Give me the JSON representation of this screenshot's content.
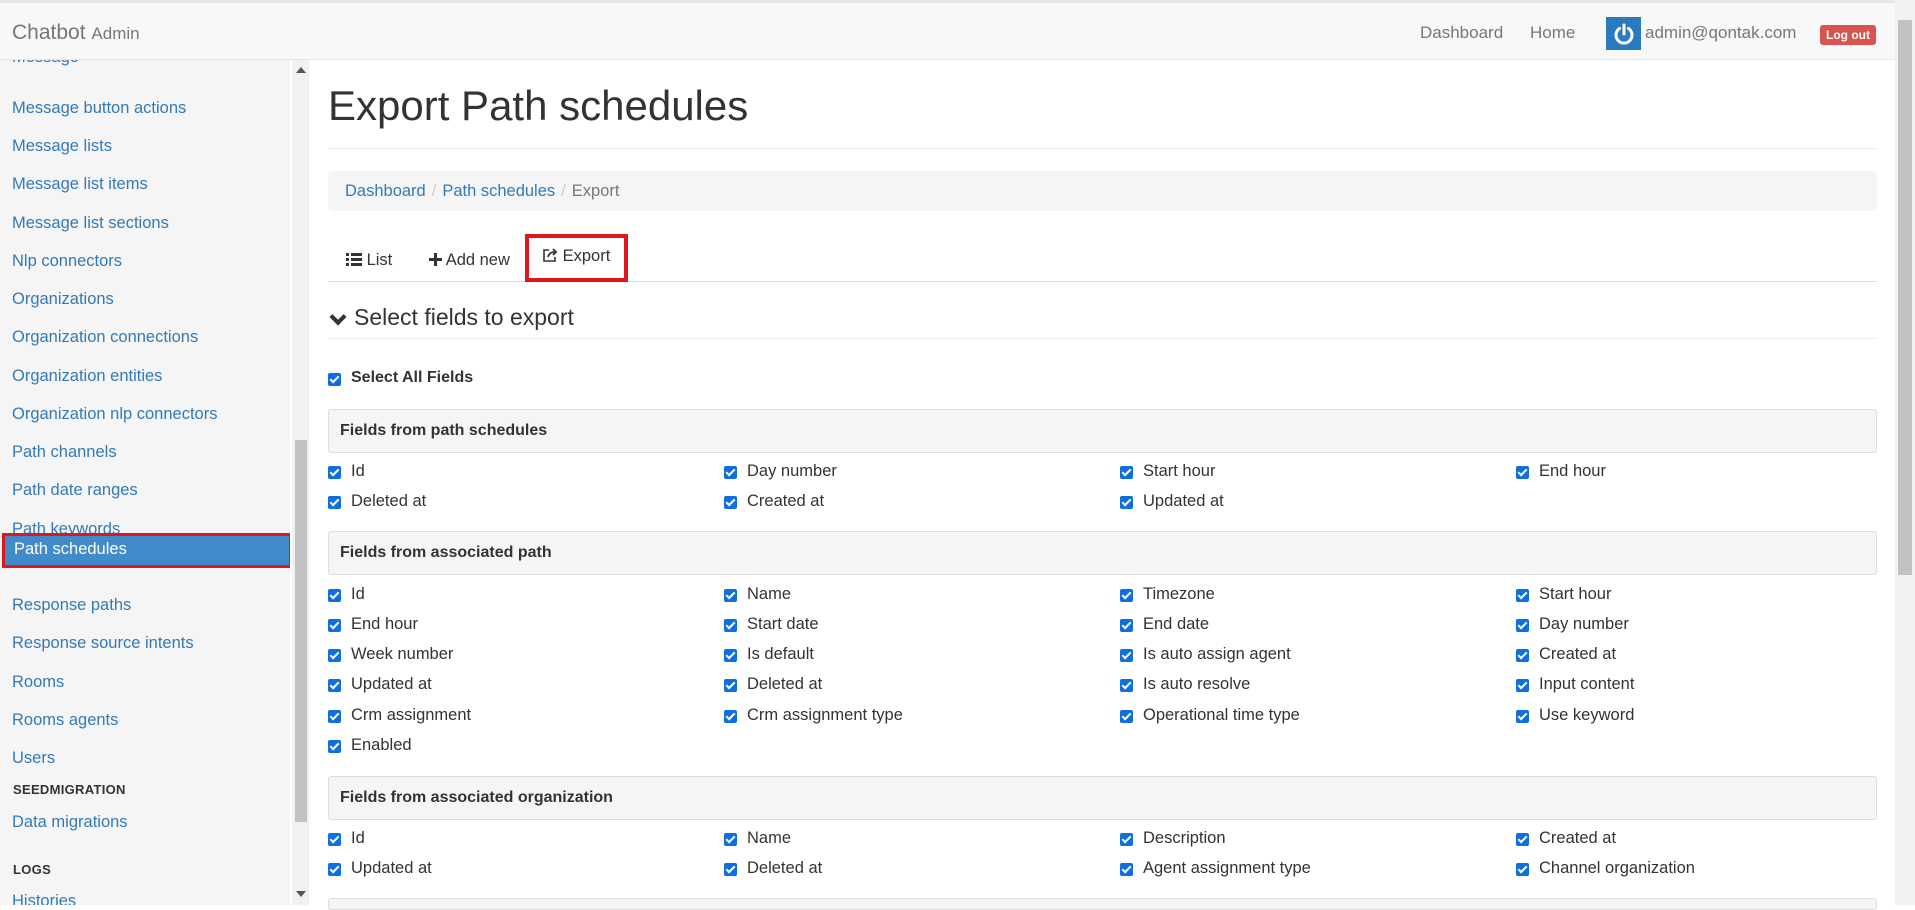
{
  "navbar": {
    "brand": "Chatbot",
    "brand_sub": "Admin",
    "links": [
      "Dashboard",
      "Home"
    ],
    "user_email": "admin@qontak.com",
    "logout_label": "Log out",
    "avatar_icon": "power-icon"
  },
  "sidebar": {
    "items": [
      "Message button actions",
      "Message lists",
      "Message list items",
      "Message list sections",
      "Nlp connectors",
      "Organizations",
      "Organization connections",
      "Organization entities",
      "Organization nlp connectors",
      "Path channels",
      "Path date ranges",
      "Path keywords",
      "Path schedules",
      "Response paths",
      "Response source intents",
      "Rooms",
      "Rooms agents",
      "Users"
    ],
    "active_item": "Path schedules",
    "seed_header": "SEEDMIGRATION",
    "seed_items": [
      "Data migrations"
    ],
    "logs_header": "LOGS",
    "logs_items": [
      "Histories"
    ]
  },
  "page": {
    "title": "Export Path schedules",
    "breadcrumb": [
      "Dashboard",
      "Path schedules",
      "Export"
    ],
    "tabs": {
      "list": "List",
      "add_new": "Add new",
      "export": "Export"
    },
    "section_title": "Select fields to export",
    "select_all_label": "Select All Fields"
  },
  "groups": [
    {
      "title": "Fields from path schedules",
      "fields": [
        "Id",
        "Day number",
        "Start hour",
        "End hour",
        "Deleted at",
        "Created at",
        "Updated at"
      ]
    },
    {
      "title": "Fields from associated path",
      "fields": [
        "Id",
        "Name",
        "Timezone",
        "Start hour",
        "End hour",
        "Start date",
        "End date",
        "Day number",
        "Week number",
        "Is default",
        "Is auto assign agent",
        "Created at",
        "Updated at",
        "Deleted at",
        "Is auto resolve",
        "Input content",
        "Crm assignment",
        "Crm assignment type",
        "Operational time type",
        "Use keyword",
        "Enabled"
      ]
    },
    {
      "title": "Fields from associated organization",
      "fields": [
        "Id",
        "Name",
        "Description",
        "Created at",
        "Updated at",
        "Deleted at",
        "Agent assignment type",
        "Channel organization"
      ]
    }
  ],
  "colors": {
    "accent": "#337ab7",
    "active_bg": "#428bca",
    "highlight_border": "#e0161e",
    "checkbox": "#0f6fe0",
    "logout": "#d9534f"
  }
}
